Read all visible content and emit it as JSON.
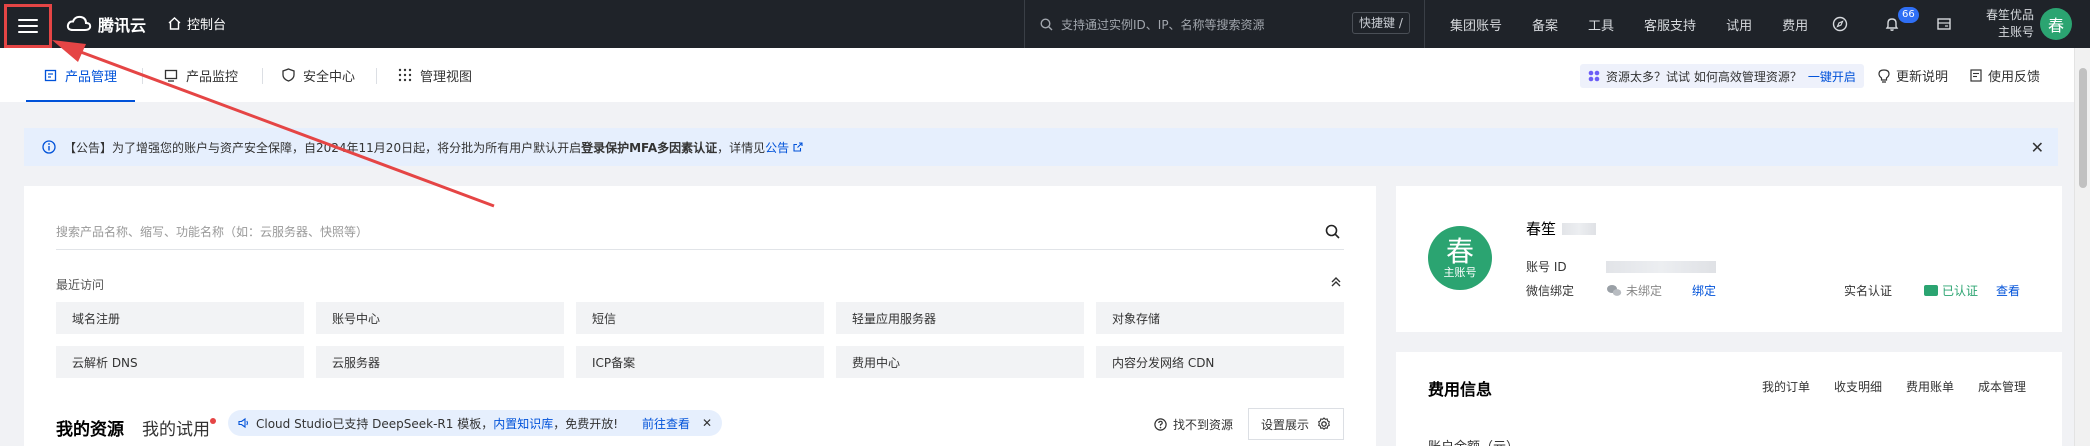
{
  "topbar": {
    "brand": "腾讯云",
    "console": "控制台",
    "search_placeholder": "支持通过实例ID、IP、名称等搜索资源",
    "shortcut": "快捷键 /",
    "nav": [
      "集团账号",
      "备案",
      "工具",
      "客服支持",
      "试用",
      "费用"
    ],
    "notification_count": "66",
    "account_name": "春笙优品",
    "account_role": "主账号",
    "avatar_char": "春"
  },
  "tabs": [
    {
      "label": "产品管理",
      "icon": "product-icon",
      "active": true
    },
    {
      "label": "产品监控",
      "icon": "monitor-icon",
      "active": false
    },
    {
      "label": "安全中心",
      "icon": "shield-icon",
      "active": false
    },
    {
      "label": "管理视图",
      "icon": "grid-dots-icon",
      "active": false
    }
  ],
  "promo": {
    "text": "资源太多？试试 如何高效管理资源？",
    "link": "一键开启"
  },
  "header_links": {
    "update": "更新说明",
    "feedback": "使用反馈"
  },
  "notice": {
    "prefix": "【公告】为了增强您的账户与资产安全保障，自2024年11月20日起，将分批为所有用户默认开启",
    "bold": "登录保护MFA多因素认证",
    "suffix": "，详情见",
    "link": "公告"
  },
  "product_search": {
    "placeholder": "搜索产品名称、缩写、功能名称（如：云服务器、快照等）"
  },
  "recent": {
    "title": "最近访问",
    "items": [
      "域名注册",
      "账号中心",
      "短信",
      "轻量应用服务器",
      "对象存储",
      "云解析 DNS",
      "云服务器",
      "ICP备案",
      "费用中心",
      "内容分发网络 CDN"
    ]
  },
  "resources": {
    "tab_mine": "我的资源",
    "tab_trial": "我的试用",
    "banner_text": "Cloud Studio已支持 DeepSeek-R1 模板，",
    "banner_link1": "内置知识库",
    "banner_text2": "，免费开放!",
    "banner_link2": "前往查看",
    "not_found": "找不到资源",
    "settings": "设置展示"
  },
  "profile": {
    "avatar_char": "春",
    "avatar_sub": "主账号",
    "name": "春笙",
    "account_id_label": "账号 ID",
    "wechat_label": "微信绑定",
    "wechat_status": "未绑定",
    "bind": "绑定",
    "realname_label": "实名认证",
    "realname_status": "已认证",
    "view": "查看"
  },
  "fees": {
    "title": "费用信息",
    "links": [
      "我的订单",
      "收支明细",
      "费用账单",
      "成本管理"
    ],
    "balance_label": "账户余额（元）"
  },
  "colors": {
    "accent": "#0052d9",
    "topbar": "#1f2329",
    "annotation": "#e54545",
    "green": "#2ba471"
  }
}
